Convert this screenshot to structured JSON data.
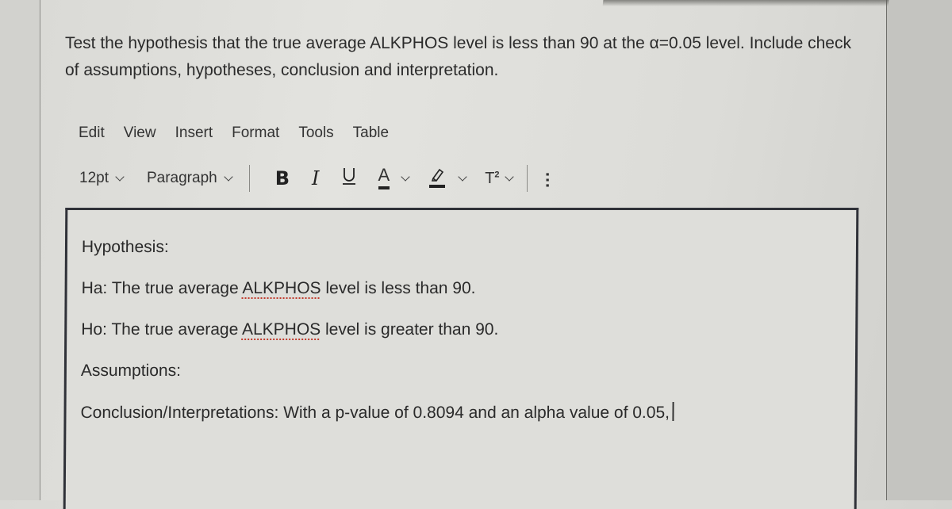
{
  "question": {
    "text": "Test the hypothesis that the true average ALKPHOS level is less than 90 at the α=0.05 level. Include check of assumptions, hypotheses, conclusion and interpretation."
  },
  "menubar": {
    "items": [
      "Edit",
      "View",
      "Insert",
      "Format",
      "Tools",
      "Table"
    ]
  },
  "toolbar": {
    "font_size": "12pt",
    "block_format": "Paragraph",
    "bold_label": "B",
    "italic_label": "I",
    "underline_label": "U",
    "text_color_label": "A",
    "superscript_label": "T",
    "superscript_exp": "2",
    "more_label": "…",
    "icons": [
      "chevron-down-icon",
      "bold-icon",
      "italic-icon",
      "underline-icon",
      "text-color-icon",
      "highlight-icon",
      "superscript-icon",
      "more-vertical-icon"
    ]
  },
  "editor": {
    "lines": [
      {
        "text": "Hypothesis:"
      },
      {
        "prefix": "Ha: The true average ",
        "flagged": "ALKPHOS",
        "suffix": " level is less than 90."
      },
      {
        "prefix": "Ho: The true average ",
        "flagged": "ALKPHOS",
        "suffix": " level is greater than 90."
      },
      {
        "text": "Assumptions:"
      },
      {
        "text": "Conclusion/Interpretations: With a p-value of 0.8094 and an alpha value of 0.05,"
      }
    ]
  },
  "colors": {
    "editor_border": "#2f3138",
    "spellcheck": "#c0392b",
    "background": "#dededa"
  }
}
